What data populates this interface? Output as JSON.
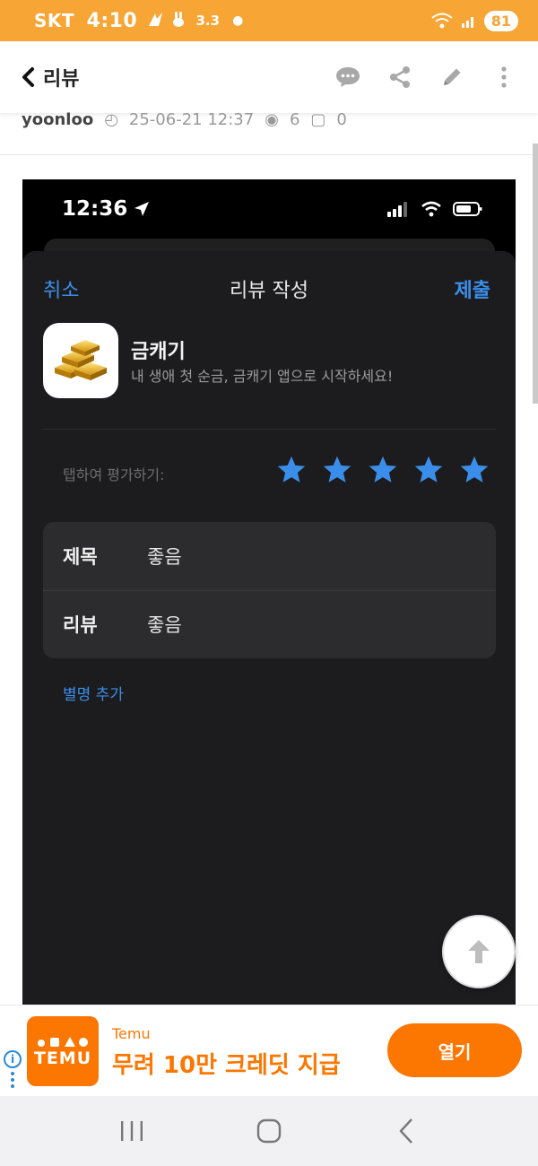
{
  "statusbar": {
    "carrier": "SKT",
    "time": "4:10",
    "indicator": "3.3",
    "battery": "81",
    "bg_color": "#f7a534"
  },
  "navbar": {
    "back_label": "리뷰",
    "icons": [
      "chat-bubble-icon",
      "share-icon",
      "edit-pencil-icon",
      "more-vertical-icon"
    ]
  },
  "post_meta": {
    "author": "yoonloo",
    "datetime": "25-06-21 12:37",
    "views": "6",
    "comments": "0"
  },
  "screenshot": {
    "ios_status": {
      "time": "12:36"
    },
    "sheet": {
      "cancel_label": "취소",
      "title": "리뷰 작성",
      "submit_label": "제출"
    },
    "app": {
      "name": "금캐기",
      "subtitle": "내 생애 첫 순금, 금캐기 앱으로 시작하세요!"
    },
    "rating": {
      "label": "탭하여 평가하기:",
      "stars_filled": 5,
      "stars_total": 5,
      "star_color": "#3a8eea"
    },
    "form": {
      "title_label": "제목",
      "title_value": "좋음",
      "review_label": "리뷰",
      "review_value": "좋음"
    },
    "nickname_link": "별명 추가"
  },
  "ad": {
    "brand": "Temu",
    "logo_text": "TEMU",
    "headline": "무려 10만 크레딧 지급",
    "cta": "열기",
    "accent": "#fb7701"
  },
  "system_nav": [
    "recents-icon",
    "home-icon",
    "back-icon"
  ]
}
